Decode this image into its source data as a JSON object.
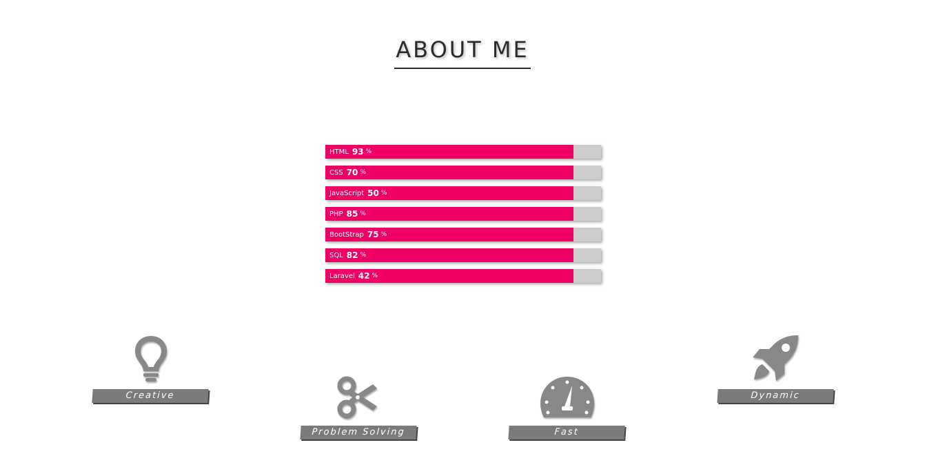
{
  "section": {
    "title": "ABOUT ME"
  },
  "colors": {
    "bar_fill": "#ee0065",
    "bar_track": "#cccccc",
    "icon": "#888888",
    "tag_bg": "#7b7b7b",
    "text": "#2b2b2b"
  },
  "skills": [
    {
      "name": "HTML",
      "percent": "93",
      "unit": "%",
      "fill": 0.9
    },
    {
      "name": "CSS",
      "percent": "70",
      "unit": "%",
      "fill": 0.9
    },
    {
      "name": "JavaScript",
      "percent": "50",
      "unit": "%",
      "fill": 0.9
    },
    {
      "name": "PHP",
      "percent": "85",
      "unit": "%",
      "fill": 0.9
    },
    {
      "name": "BootStrap",
      "percent": "75",
      "unit": "%",
      "fill": 0.9
    },
    {
      "name": "SQL",
      "percent": "82",
      "unit": "%",
      "fill": 0.9
    },
    {
      "name": "Laravel",
      "percent": "42",
      "unit": "%",
      "fill": 0.9
    }
  ],
  "features": [
    {
      "label": "Creative",
      "icon": "lightbulb-icon"
    },
    {
      "label": "Problem Solving",
      "icon": "scissors-icon"
    },
    {
      "label": "Fast",
      "icon": "speedometer-icon"
    },
    {
      "label": "Dynamic",
      "icon": "rocket-icon"
    }
  ]
}
